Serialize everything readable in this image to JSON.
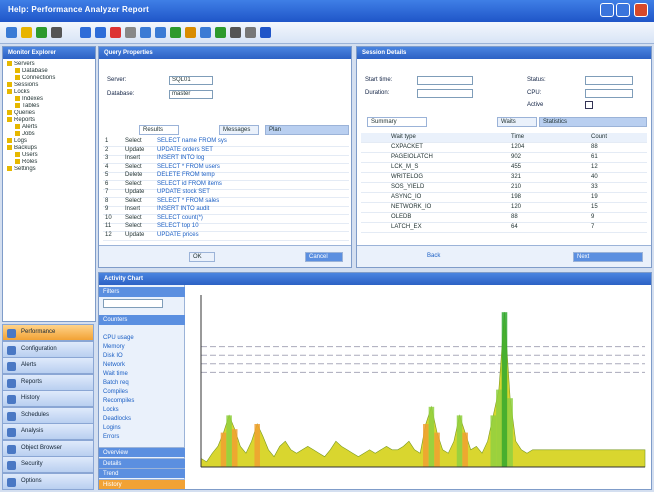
{
  "app": {
    "title": "Help: Performance Analyzer Report"
  },
  "toolbar": {
    "icons": [
      "new-icon",
      "open-icon",
      "save-icon",
      "print-icon",
      "back-icon",
      "forward-icon",
      "delete-icon",
      "cut-icon",
      "copy-icon",
      "paste-icon",
      "grid-icon",
      "chart-icon",
      "filter-icon",
      "refresh-icon",
      "zoom-icon",
      "settings-icon",
      "help-icon"
    ]
  },
  "left_panel": {
    "title": "Monitor Explorer",
    "tree": [
      "Servers",
      "Database",
      "Connections",
      "Sessions",
      "Locks",
      "Indexes",
      "Tables",
      "Queries",
      "Reports",
      "Alerts",
      "Jobs",
      "Logs",
      "Backups",
      "Users",
      "Roles",
      "Settings"
    ],
    "nav": [
      "Performance",
      "Configuration",
      "Alerts",
      "Reports",
      "History",
      "Schedules",
      "Analysis",
      "Object Browser",
      "Security",
      "Options"
    ]
  },
  "top_left_panel": {
    "title": "Query Properties",
    "fields": [
      {
        "label": "Server:",
        "value": "SQL01"
      },
      {
        "label": "Database:",
        "value": "master"
      }
    ],
    "tabs": [
      "Results",
      "Messages",
      "Plan"
    ],
    "rows": [
      [
        "1",
        "Select",
        "SELECT name FROM sys"
      ],
      [
        "2",
        "Update",
        "UPDATE orders SET"
      ],
      [
        "3",
        "Insert",
        "INSERT INTO log"
      ],
      [
        "4",
        "Select",
        "SELECT * FROM users"
      ],
      [
        "5",
        "Delete",
        "DELETE FROM temp"
      ],
      [
        "6",
        "Select",
        "SELECT id FROM items"
      ],
      [
        "7",
        "Update",
        "UPDATE stock SET"
      ],
      [
        "8",
        "Select",
        "SELECT * FROM sales"
      ],
      [
        "9",
        "Insert",
        "INSERT INTO audit"
      ],
      [
        "10",
        "Select",
        "SELECT count(*)"
      ],
      [
        "11",
        "Select",
        "SELECT top 10"
      ],
      [
        "12",
        "Update",
        "UPDATE prices"
      ]
    ],
    "footer_buttons": [
      "OK",
      "Cancel"
    ]
  },
  "top_right_panel": {
    "title": "Session Details",
    "labels": [
      "Start time:",
      "Duration:",
      "Status:",
      "CPU:",
      "Active"
    ],
    "tabs": [
      "Summary",
      "Waits",
      "Statistics"
    ],
    "rows": [
      [
        "Wait type",
        "Time",
        "Count"
      ],
      [
        "CXPACKET",
        "1204",
        "88"
      ],
      [
        "PAGEIOLATCH",
        "902",
        "61"
      ],
      [
        "LCK_M_S",
        "455",
        "12"
      ],
      [
        "WRITELOG",
        "321",
        "40"
      ],
      [
        "SOS_YIELD",
        "210",
        "33"
      ],
      [
        "ASYNC_IO",
        "198",
        "19"
      ],
      [
        "NETWORK_IO",
        "120",
        "15"
      ],
      [
        "OLEDB",
        "88",
        "9"
      ],
      [
        "LATCH_EX",
        "64",
        "7"
      ]
    ],
    "footer": [
      "Back",
      "Next"
    ]
  },
  "bottom_panel": {
    "title": "Activity Chart",
    "side_sections": [
      "Filters",
      "Counters",
      "Events"
    ],
    "side_items": [
      "CPU usage",
      "Memory",
      "Disk IO",
      "Network",
      "Wait time",
      "Batch req",
      "Compiles",
      "Recompiles",
      "Locks",
      "Deadlocks",
      "Logins",
      "Errors"
    ],
    "side_tabs": [
      "Overview",
      "Details",
      "Trend",
      "History"
    ]
  },
  "chart_data": {
    "type": "area",
    "x": [
      0,
      1,
      2,
      3,
      4,
      5,
      6,
      7,
      8,
      9,
      10,
      11,
      12,
      13,
      14,
      15,
      16,
      17,
      18,
      19,
      20,
      21,
      22,
      23,
      24,
      25,
      26,
      27,
      28,
      29,
      30,
      31,
      32,
      33,
      34,
      35,
      36,
      37,
      38,
      39,
      40,
      41,
      42,
      43,
      44,
      45,
      46,
      47,
      48,
      49,
      50,
      51,
      52,
      53,
      54,
      55,
      56,
      57,
      58,
      59,
      60,
      61,
      62,
      63,
      64,
      65,
      66,
      67,
      68,
      69,
      70,
      71,
      72,
      73,
      74,
      75,
      76,
      77,
      78,
      79
    ],
    "values": [
      5,
      3,
      8,
      12,
      20,
      30,
      22,
      12,
      8,
      15,
      25,
      18,
      10,
      6,
      12,
      15,
      10,
      8,
      10,
      12,
      10,
      8,
      6,
      10,
      15,
      12,
      10,
      8,
      6,
      8,
      10,
      8,
      10,
      12,
      10,
      10,
      12,
      15,
      10,
      8,
      25,
      35,
      20,
      10,
      8,
      15,
      30,
      20,
      10,
      12,
      8,
      15,
      30,
      45,
      90,
      40,
      15,
      10,
      8,
      10,
      10,
      10,
      10,
      10,
      10,
      10,
      10,
      10,
      10,
      10,
      10,
      10,
      10,
      10,
      10,
      10,
      10,
      10,
      10,
      10
    ],
    "ylim": [
      0,
      100
    ],
    "grid": true,
    "color_series": [
      "#e8e040",
      "#8fd040",
      "#f0a030",
      "#2ea82e"
    ]
  },
  "colors": {
    "accent": "#2c61c4",
    "active_nav": "#f2a235",
    "chart_fill": "#d9d62f"
  }
}
